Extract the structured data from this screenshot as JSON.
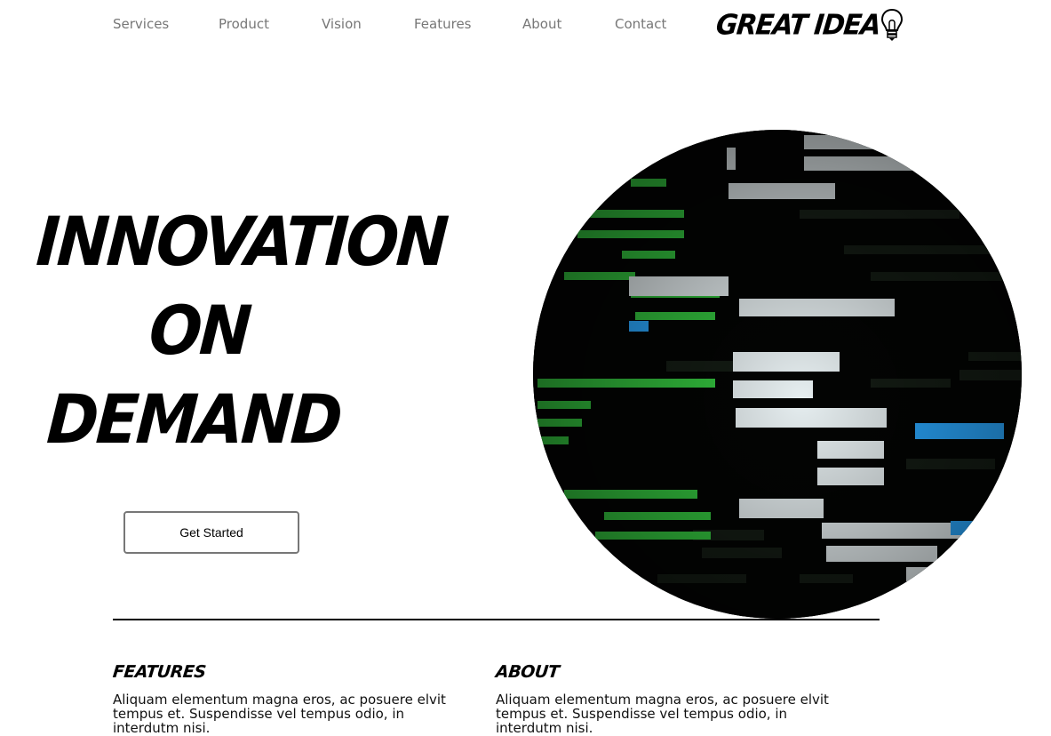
{
  "nav": {
    "items": [
      {
        "label": "Services"
      },
      {
        "label": "Product"
      },
      {
        "label": "Vision"
      },
      {
        "label": "Features"
      },
      {
        "label": "About"
      },
      {
        "label": "Contact"
      }
    ],
    "logo_text": "GREAT IDEA"
  },
  "hero": {
    "title_lines": [
      "INNOVATION",
      "ON",
      "DEMAND"
    ],
    "cta_label": "Get Started",
    "image_icon": "code-screen-image"
  },
  "sections": [
    {
      "title": "FEATURES",
      "text": "Aliquam elementum magna eros, ac posuere elvit tempus et. Suspendisse vel tempus odio, in interdutm nisi."
    },
    {
      "title": "ABOUT",
      "text": "Aliquam elementum magna eros, ac posuere elvit tempus et. Suspendisse vel tempus odio, in interdutm nisi."
    }
  ],
  "colors": {
    "nav_text": "#777777",
    "code_bg": "#030403",
    "code_green": "#3fd14a",
    "code_blue": "#2aa8ff"
  }
}
